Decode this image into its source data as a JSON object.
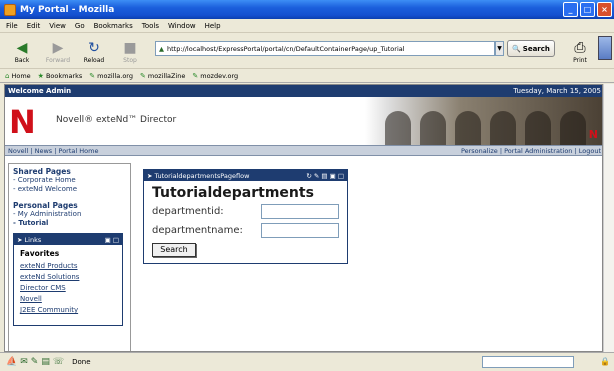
{
  "window": {
    "title": "My Portal - Mozilla"
  },
  "menu": [
    "File",
    "Edit",
    "View",
    "Go",
    "Bookmarks",
    "Tools",
    "Window",
    "Help"
  ],
  "nav": {
    "back": "Back",
    "forward": "Forward",
    "reload": "Reload",
    "stop": "Stop",
    "url": "http://localhost/ExpressPortal/portal/cn/DefaultContainerPage/up_Tutorial",
    "search": "Search",
    "print": "Print"
  },
  "bookmarks": [
    "Home",
    "Bookmarks",
    "mozilla.org",
    "mozillaZine",
    "mozdev.org"
  ],
  "page": {
    "welcome": "Welcome Admin",
    "date": "Tuesday, March 15, 2005",
    "brand": "Novell® exteNd™ Director",
    "top_links_left": "Novell | News | Portal Home",
    "top_links_right": "Personalize | Portal Administration | Logout",
    "shared_title": "Shared Pages",
    "shared": [
      "- Corporate Home",
      "- exteNd Welcome"
    ],
    "personal_title": "Personal Pages",
    "personal": [
      "- My Administration",
      "- Tutorial"
    ],
    "links_portlet": {
      "title": "Links",
      "favorites_title": "Favorites",
      "items": [
        "exteNd Products",
        "exteNd Solutions",
        "Director CMS",
        "Novell",
        "J2EE Community"
      ]
    },
    "tutorial_portlet": {
      "header": "TutorialdepartmentsPageflow",
      "title": "Tutorialdepartments",
      "field1": "departmentid:",
      "field2": "departmentname:",
      "button": "Search"
    }
  },
  "status": {
    "text": "Done"
  }
}
